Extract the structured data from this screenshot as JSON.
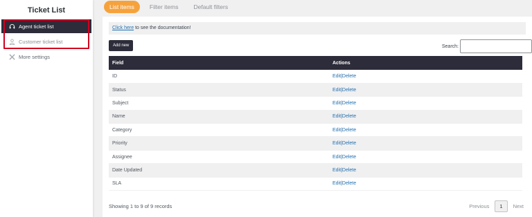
{
  "sidebar": {
    "title": "Ticket List",
    "items": [
      {
        "label": "Agent ticket list"
      },
      {
        "label": "Customer ticket list"
      },
      {
        "label": "More settings"
      }
    ]
  },
  "tabs": [
    {
      "label": "List items"
    },
    {
      "label": "Filter items"
    },
    {
      "label": "Default filters"
    }
  ],
  "notice": {
    "link_text": "Click here",
    "rest_text": " to see the documentation!"
  },
  "toolbar": {
    "add_label": "Add new",
    "search_label": "Search:",
    "search_value": ""
  },
  "table": {
    "headers": [
      "Field",
      "Actions"
    ],
    "rows": [
      {
        "field": "ID"
      },
      {
        "field": "Status"
      },
      {
        "field": "Subject"
      },
      {
        "field": "Name"
      },
      {
        "field": "Category"
      },
      {
        "field": "Priority"
      },
      {
        "field": "Assignee"
      },
      {
        "field": "Date Updated"
      },
      {
        "field": "SLA"
      }
    ],
    "edit_label": "Edit",
    "separator": "|",
    "delete_label": "Delete"
  },
  "footer": {
    "info": "Showing 1 to 9 of 9 records",
    "previous": "Previous",
    "current_page": "1",
    "next": "Next"
  },
  "colors": {
    "accent": "#f6a23c",
    "dark": "#2c2c3a",
    "highlight": "#d1001f",
    "link": "#2271b1"
  }
}
